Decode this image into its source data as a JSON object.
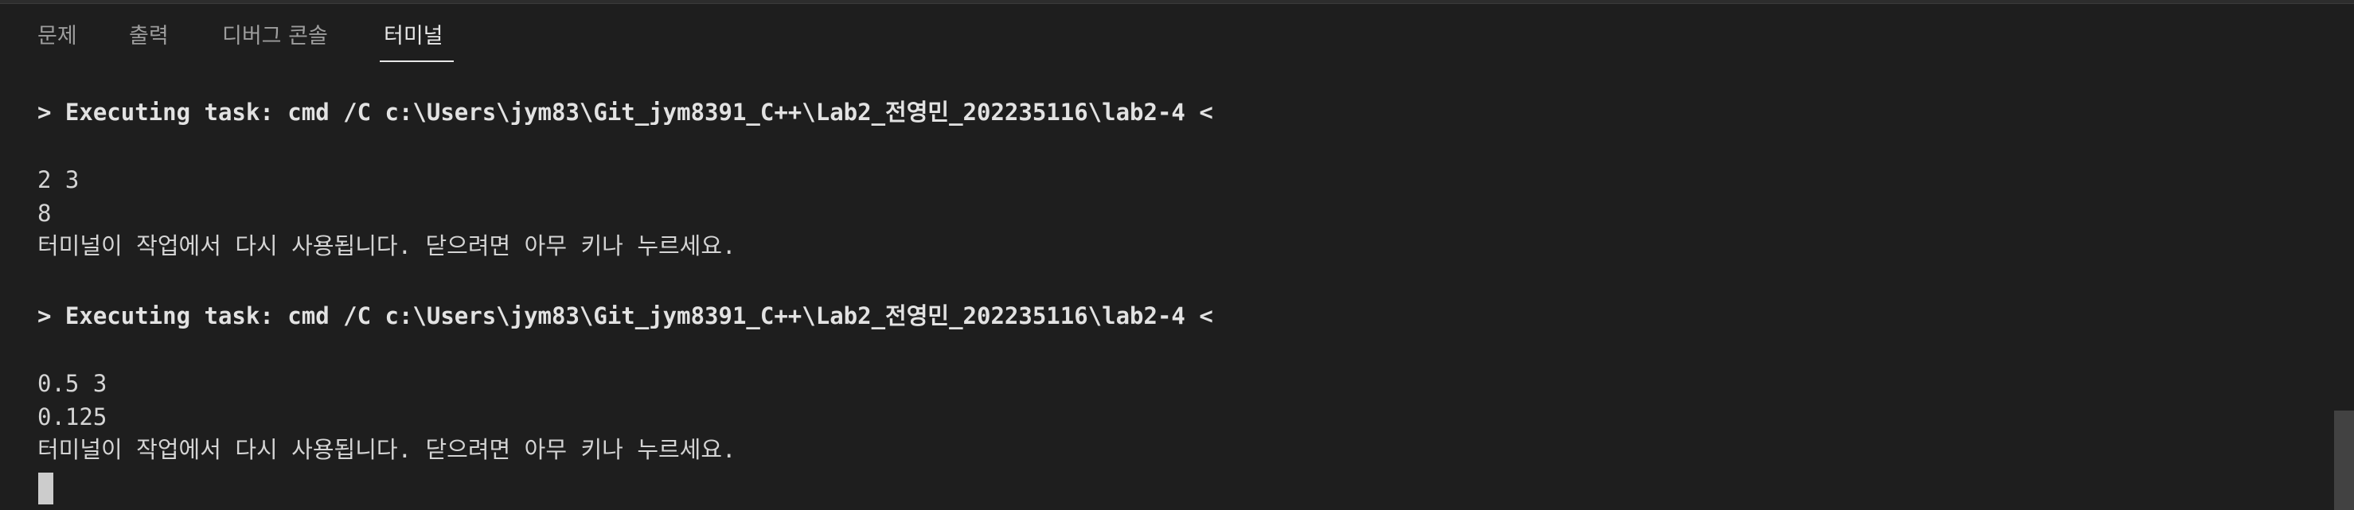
{
  "panel": {
    "tabs": [
      {
        "label": "문제",
        "active": false
      },
      {
        "label": "출력",
        "active": false
      },
      {
        "label": "디버그 콘솔",
        "active": false
      },
      {
        "label": "터미널",
        "active": true
      }
    ]
  },
  "terminal": {
    "lines": [
      "> Executing task: cmd /C c:\\Users\\jym83\\Git_jym8391_C++\\Lab2_전영민_202235116\\lab2-4 <",
      "2 3",
      "8",
      "터미널이 작업에서 다시 사용됩니다. 닫으려면 아무 키나 누르세요.",
      "> Executing task: cmd /C c:\\Users\\jym83\\Git_jym8391_C++\\Lab2_전영민_202235116\\lab2-4 <",
      "0.5 3",
      "0.125",
      "터미널이 작업에서 다시 사용됩니다. 닫으려면 아무 키나 누르세요."
    ]
  },
  "colors": {
    "background": "#1e1e1e",
    "tab_active": "#e7e7e7",
    "tab_inactive": "#9d9d9d",
    "text": "#d4d4d4",
    "cursor": "#cccccc",
    "scroll_thumb": "#424242"
  }
}
